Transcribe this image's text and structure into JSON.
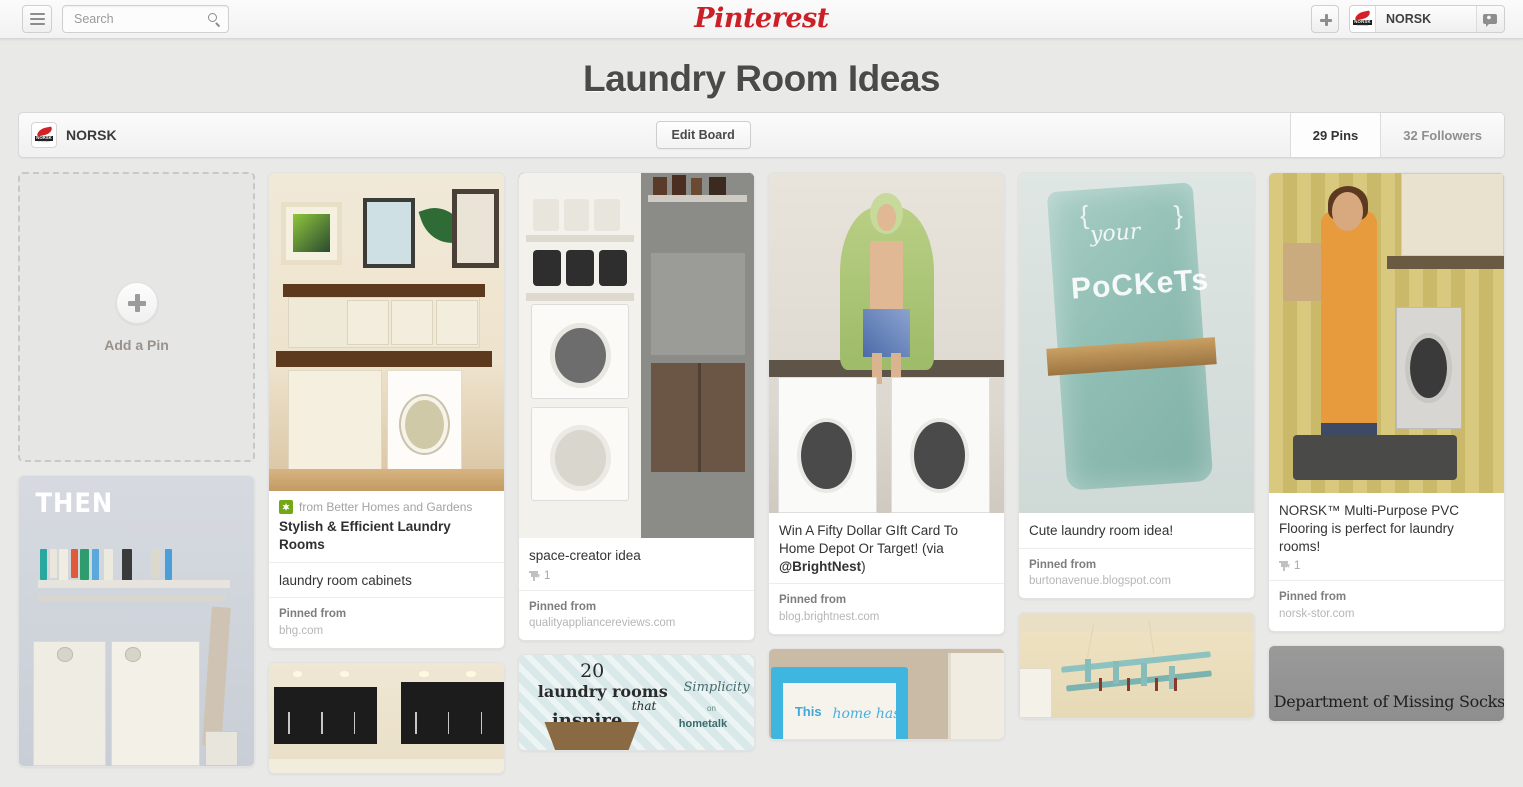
{
  "nav": {
    "menu_icon": "hamburger-icon",
    "search": {
      "value": "",
      "placeholder": "Search",
      "icon": "search-icon"
    },
    "brand": "Pinterest",
    "add_icon": "plus-icon",
    "user_name": "NORSK",
    "messages_icon": "messages-pin-icon"
  },
  "page": {
    "title": "Laundry Room Ideas"
  },
  "board_bar": {
    "owner": "NORSK",
    "edit_label": "Edit Board",
    "pins_stat": "29 Pins",
    "followers_stat": "32 Followers"
  },
  "add_pin": {
    "label": "Add a Pin",
    "icon": "plus-circle-icon"
  },
  "labels": {
    "pinned_from": "Pinned from"
  },
  "pins": [
    {
      "source_text": "from Better Homes and Gardens",
      "favicon": "bhg-flower-icon",
      "title": "Stylish & Efficient Laundry Rooms",
      "note": "laundry room cabinets",
      "pinned_from": "Pinned from",
      "domain": "bhg.com"
    },
    {
      "note": "space-creator idea",
      "repins": "1",
      "pinned_from": "Pinned from",
      "domain": "qualityappliancereviews.com"
    },
    {
      "note_plain": "Win A Fifty Dollar GIft Card To Home Depot Or Target! (via ",
      "note_mention": "@BrightNest",
      "note_tail": ")",
      "pinned_from": "Pinned from",
      "domain": "blog.brightnest.com"
    },
    {
      "note": "Cute laundry room idea!",
      "pinned_from": "Pinned from",
      "domain": "burtonavenue.blogspot.com"
    },
    {
      "note": "NORSK™ Multi-Purpose PVC Flooring is perfect for laundry rooms!",
      "repins": "1",
      "pinned_from": "Pinned from",
      "domain": "norsk-stor.com"
    }
  ],
  "image_overlays": {
    "then_label": "THEN",
    "twenty_number": "20",
    "twenty_line1": "laundry rooms",
    "twenty_that": "that",
    "twenty_inspire": "inspire",
    "simplicity": "Simplicity",
    "on": "on",
    "hometalk": "hometalk",
    "pockets_brace_open": "{",
    "pockets_brace_close": "}",
    "pockets_your": "your",
    "pockets_word": "PoCKeTs",
    "frame_text1": "This",
    "frame_text2": "home has",
    "socks_text": "Department of Missing Socks"
  },
  "colors": {
    "brand_red": "#cb2027",
    "page_bg": "#e9e9e7",
    "card_bg": "#ffffff",
    "title_gray": "#4a4a4a"
  }
}
